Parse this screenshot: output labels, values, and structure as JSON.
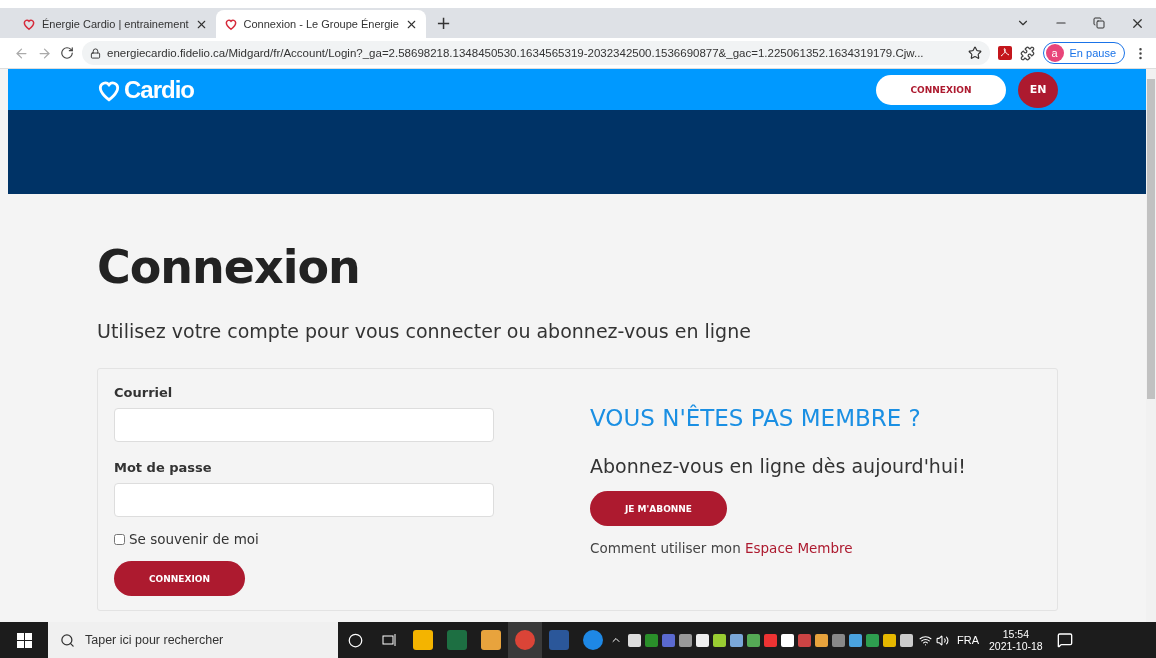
{
  "browser": {
    "tabs": [
      {
        "title": "Énergie Cardio | entrainement",
        "selected": false
      },
      {
        "title": "Connexion - Le Groupe Énergie",
        "selected": true
      }
    ],
    "new_tab": "+",
    "url": "energiecardio.fidelio.ca/Midgard/fr/Account/Login?_ga=2.58698218.1348450530.1634565319-2032342500.1536690877&_gac=1.225061352.1634319179.Cjw...",
    "profile": {
      "initial": "a",
      "status": "En pause"
    }
  },
  "header": {
    "logo": "Cardio",
    "login_button": "CONNEXION",
    "language_button": "EN"
  },
  "page": {
    "title": "Connexion",
    "subtitle": "Utilisez votre compte pour vous connecter ou abonnez-vous en ligne",
    "form": {
      "email_label": "Courriel",
      "password_label": "Mot de passe",
      "remember": {
        "label": "Se souvenir de moi",
        "checked": false
      },
      "submit": "CONNEXION"
    },
    "signup": {
      "heading": "VOUS N'ÊTES PAS MEMBRE ?",
      "text": "Abonnez-vous en ligne dès aujourd'hui!",
      "button": "JE M'ABONNE",
      "help_text": "Comment utiliser mon ",
      "help_link": "Espace Membre"
    }
  },
  "taskbar": {
    "search_placeholder": "Taper ici pour rechercher",
    "language": "FRA",
    "time": "15:54",
    "date": "2021-10-18"
  }
}
